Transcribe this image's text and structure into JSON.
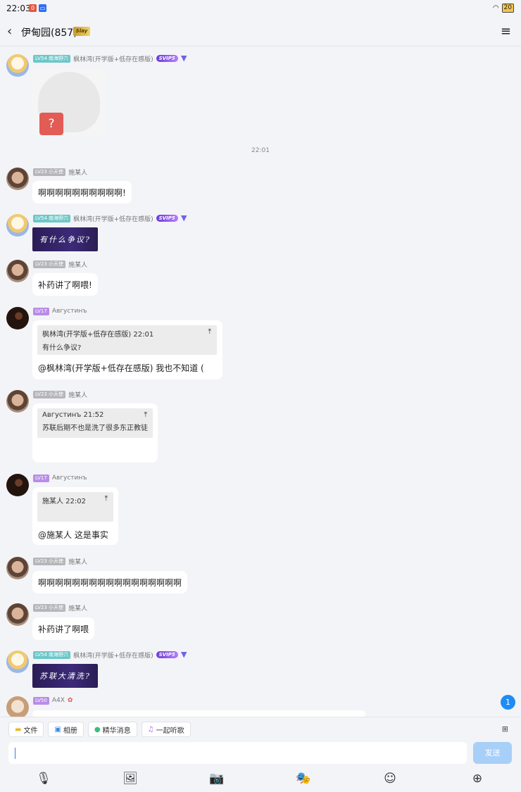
{
  "status": {
    "time": "22:03",
    "badge1": "0",
    "battery": "20"
  },
  "header": {
    "back_glyph": "‹",
    "title": "伊甸园(857)",
    "title_badge": "Slay",
    "menu_glyph": "≡"
  },
  "time_divider": "22:01",
  "messages": [
    {
      "type": "sticker",
      "level": "LV54 南海野穴",
      "name": "枫林湾(开学版+低存在感版)",
      "svip": "SVIP5",
      "sticker_symbol": "?"
    },
    {
      "type": "text",
      "level": "LV23 小天使",
      "name": "施某人",
      "text": "啊啊啊啊啊啊啊啊啊啊!"
    },
    {
      "type": "tag-sticker",
      "level": "LV54 南海野穴",
      "name": "枫林湾(开学版+低存在感版)",
      "svip": "SVIP5",
      "tag": "有什么争议?"
    },
    {
      "type": "text",
      "level": "LV23 小天使",
      "name": "施某人",
      "text": "补药讲了啊喂!"
    },
    {
      "type": "reply",
      "level": "LV17",
      "name": "Августинъ",
      "quote_head": "枫林湾(开学版+低存在感版) 22:01",
      "quote_body": "有什么争议?",
      "text": "@枫林湾(开学版+低存在感版) 我也不知道 ("
    },
    {
      "type": "reply",
      "level": "LV23 小天使",
      "name": "施某人",
      "quote_head": "Августинъ 21:52",
      "quote_body": "苏联后期不也是洗了很多东正教徒",
      "text": ""
    },
    {
      "type": "reply",
      "level": "LV17",
      "name": "Августинъ",
      "quote_head": "施某人 22:02",
      "quote_body": "",
      "text": "@施某人 这是事实"
    },
    {
      "type": "text",
      "level": "LV23 小天使",
      "name": "施某人",
      "text": "啊啊啊啊啊啊啊啊啊啊啊啊啊啊啊啊啊"
    },
    {
      "type": "text",
      "level": "LV23 小天使",
      "name": "施某人",
      "text": "补药讲了啊喂"
    },
    {
      "type": "tag-sticker",
      "level": "LV54 南海野穴",
      "name": "枫林湾(开学版+低存在感版)",
      "svip": "SVIP5",
      "tag": "苏联大清洗?"
    },
    {
      "type": "partial",
      "level": "LV50",
      "name": "A4X"
    }
  ],
  "unread_count": "1",
  "chips": [
    {
      "icon": "folder-icon",
      "glyph": "▬",
      "label": "文件",
      "color": "#f0b429"
    },
    {
      "icon": "image-icon",
      "glyph": "▣",
      "label": "相册",
      "color": "#3a86e8"
    },
    {
      "icon": "star-icon",
      "glyph": "●",
      "label": "精华消息",
      "color": "#34c27a"
    },
    {
      "icon": "music-icon",
      "glyph": "♫",
      "label": "一起听歌",
      "color": "#a86ce8"
    }
  ],
  "input": {
    "placeholder": ""
  },
  "send_label": "发送",
  "toolbar": [
    {
      "name": "mic-icon",
      "glyph": "🎙"
    },
    {
      "name": "gallery-icon",
      "glyph": "🖼"
    },
    {
      "name": "camera-icon",
      "glyph": "📷"
    },
    {
      "name": "sticker-icon",
      "glyph": "🎭"
    },
    {
      "name": "emoji-icon",
      "glyph": "☺"
    },
    {
      "name": "plus-icon",
      "glyph": "⊕"
    }
  ]
}
